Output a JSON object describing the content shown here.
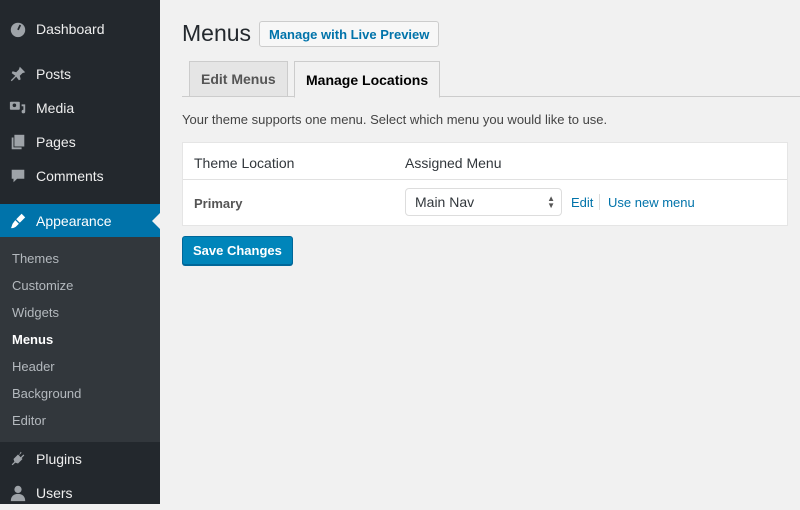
{
  "sidebar": {
    "items": [
      {
        "label": "Dashboard",
        "icon": "dashboard-icon"
      },
      {
        "label": "Posts",
        "icon": "pin-icon"
      },
      {
        "label": "Media",
        "icon": "media-icon"
      },
      {
        "label": "Pages",
        "icon": "pages-icon"
      },
      {
        "label": "Comments",
        "icon": "comment-icon"
      },
      {
        "label": "Appearance",
        "icon": "paintbrush-icon"
      },
      {
        "label": "Plugins",
        "icon": "plug-icon"
      },
      {
        "label": "Users",
        "icon": "user-icon"
      }
    ],
    "submenu": [
      "Themes",
      "Customize",
      "Widgets",
      "Menus",
      "Header",
      "Background",
      "Editor"
    ],
    "current_sub": "Menus"
  },
  "header": {
    "title": "Menus",
    "live_preview_label": "Manage with Live Preview"
  },
  "tabs": [
    {
      "label": "Edit Menus",
      "active": false
    },
    {
      "label": "Manage Locations",
      "active": true
    }
  ],
  "description": "Your theme supports one menu. Select which menu you would like to use.",
  "table": {
    "headers": [
      "Theme Location",
      "Assigned Menu"
    ],
    "rows": [
      {
        "location": "Primary",
        "menu": "Main Nav",
        "edit_label": "Edit",
        "new_label": "Use new menu"
      }
    ]
  },
  "save_label": "Save Changes",
  "colors": {
    "accent": "#0073aa",
    "sidebar": "#23282d",
    "button": "#0085ba"
  }
}
